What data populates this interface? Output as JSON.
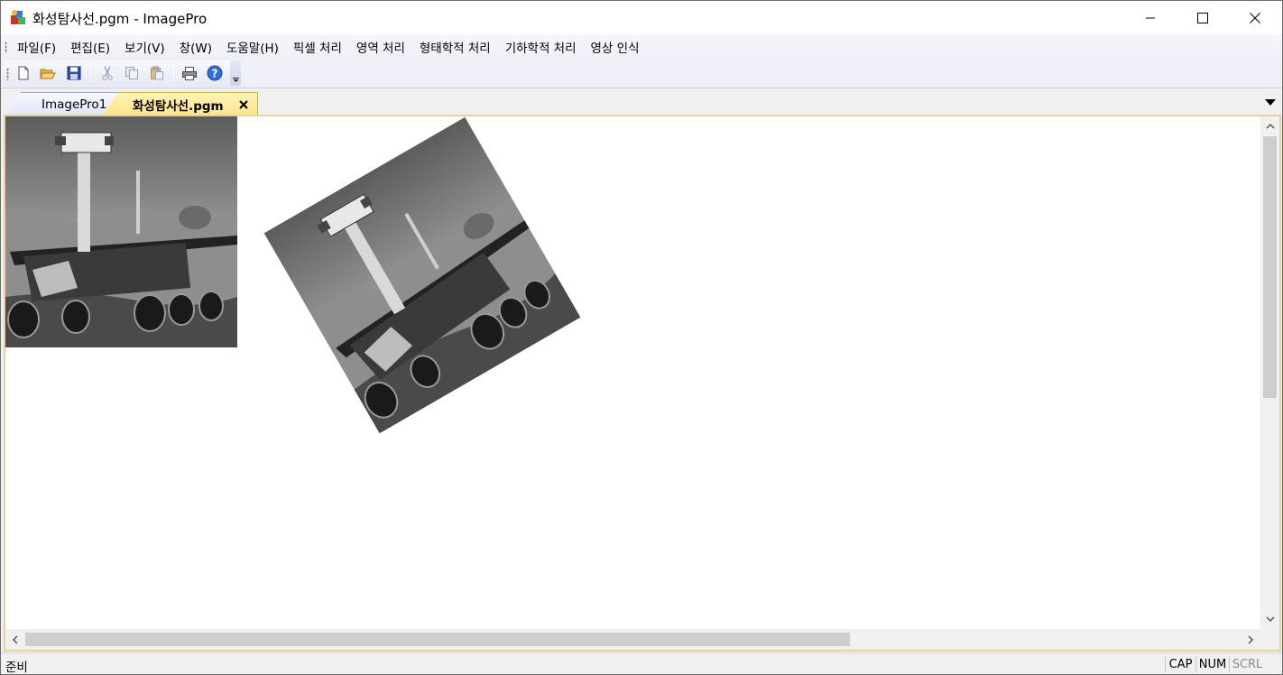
{
  "window": {
    "title": "화성탐사선.pgm - ImagePro",
    "minimize_icon": "minimize-icon",
    "maximize_icon": "maximize-icon",
    "close_icon": "close-icon"
  },
  "menu": {
    "items": [
      {
        "label": "파일(F)"
      },
      {
        "label": "편집(E)"
      },
      {
        "label": "보기(V)"
      },
      {
        "label": "창(W)"
      },
      {
        "label": "도움말(H)"
      },
      {
        "label": "픽셀 처리"
      },
      {
        "label": "영역 처리"
      },
      {
        "label": "형태학적 처리"
      },
      {
        "label": "기하학적 처리"
      },
      {
        "label": "영상 인식"
      }
    ]
  },
  "toolbar": {
    "buttons": [
      {
        "icon": "new-file-icon"
      },
      {
        "icon": "open-folder-icon"
      },
      {
        "icon": "save-icon"
      },
      {
        "icon": "cut-icon"
      },
      {
        "icon": "copy-icon"
      },
      {
        "icon": "paste-icon"
      },
      {
        "icon": "print-icon"
      },
      {
        "icon": "help-icon"
      }
    ]
  },
  "tabs": {
    "inactive_label": "ImagePro1",
    "active_label": "화성탐사선.pgm"
  },
  "document": {
    "images": [
      {
        "description_icon": "mars-rover-image",
        "rotation_deg": 0
      },
      {
        "description_icon": "mars-rover-image",
        "rotation_deg": -30
      }
    ]
  },
  "status": {
    "text": "준비",
    "cap": "CAP",
    "num": "NUM",
    "scrl": "SCRL"
  },
  "colors": {
    "active_tab": "#ffe48a",
    "doc_border": "#e7d29a",
    "menubar_bg": "#eef0f8"
  }
}
